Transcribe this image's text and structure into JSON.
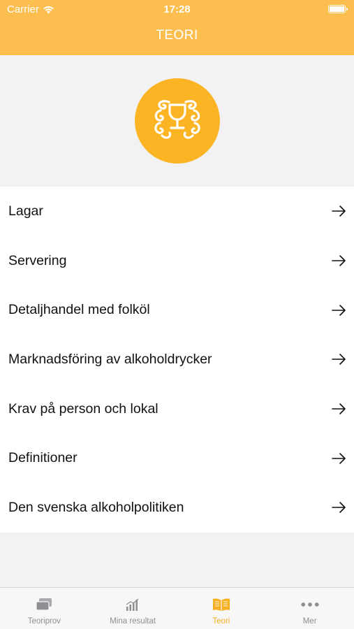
{
  "status": {
    "carrier": "Carrier",
    "time": "17:28"
  },
  "header": {
    "title": "TEORI"
  },
  "logo": {
    "icon": "wine-glass-ornament-icon",
    "color": "#fbb424"
  },
  "menu": [
    {
      "label": "Lagar"
    },
    {
      "label": "Servering"
    },
    {
      "label": "Detaljhandel med folköl"
    },
    {
      "label": "Marknadsföring av alkoholdrycker"
    },
    {
      "label": "Krav på person och lokal"
    },
    {
      "label": "Definitioner"
    },
    {
      "label": "Den svenska alkoholpolitiken"
    }
  ],
  "tabs": [
    {
      "label": "Teoriprov",
      "icon": "cards-icon"
    },
    {
      "label": "Mina resultat",
      "icon": "bar-chart-icon"
    },
    {
      "label": "Teori",
      "icon": "book-icon",
      "active": true
    },
    {
      "label": "Mer",
      "icon": "more-dots-icon"
    }
  ],
  "colors": {
    "accent": "#fcbe4e",
    "active_tab": "#f7ae1f",
    "inactive_tab": "#8e8e93"
  }
}
